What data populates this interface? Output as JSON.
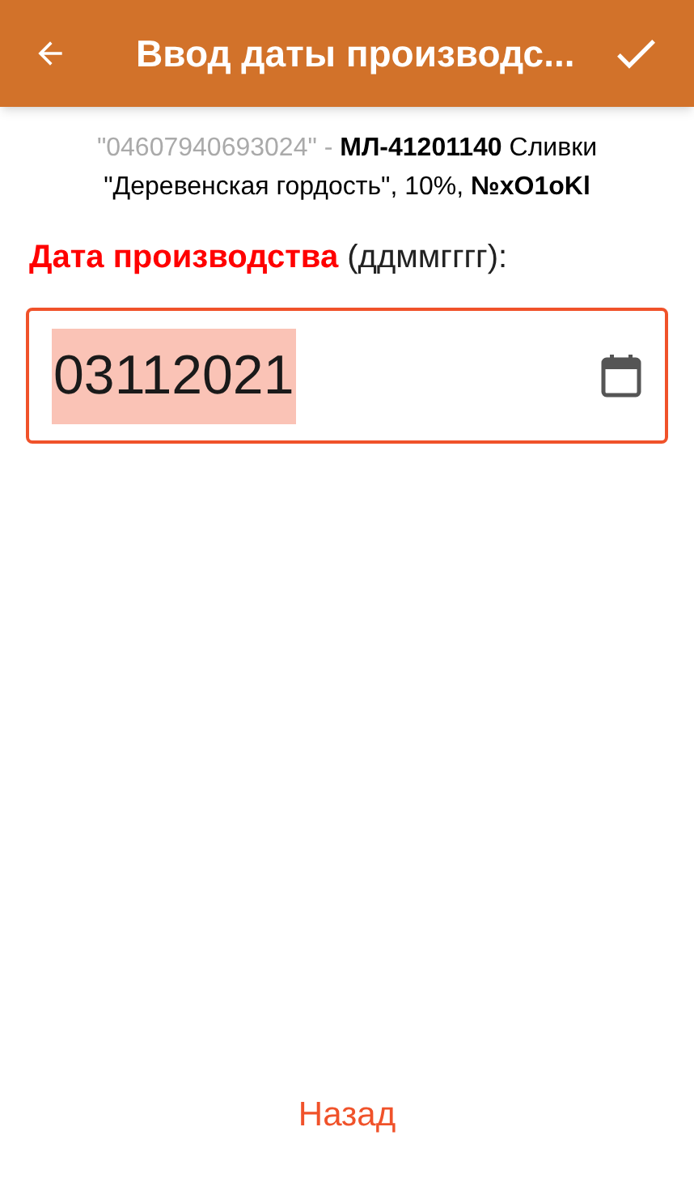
{
  "app_bar": {
    "title": "Ввод даты производс..."
  },
  "product": {
    "barcode": "\"04607940693024\" -",
    "description": "**МЛ-41201140** Сливки \"Деревенская гордость\", 10%, **№xO1oKl**"
  },
  "date_field": {
    "label": "**Дата производства** (ддммгггг):",
    "value": "03112021",
    "text_selected": true
  },
  "back_button": {
    "label": "Назад"
  }
}
